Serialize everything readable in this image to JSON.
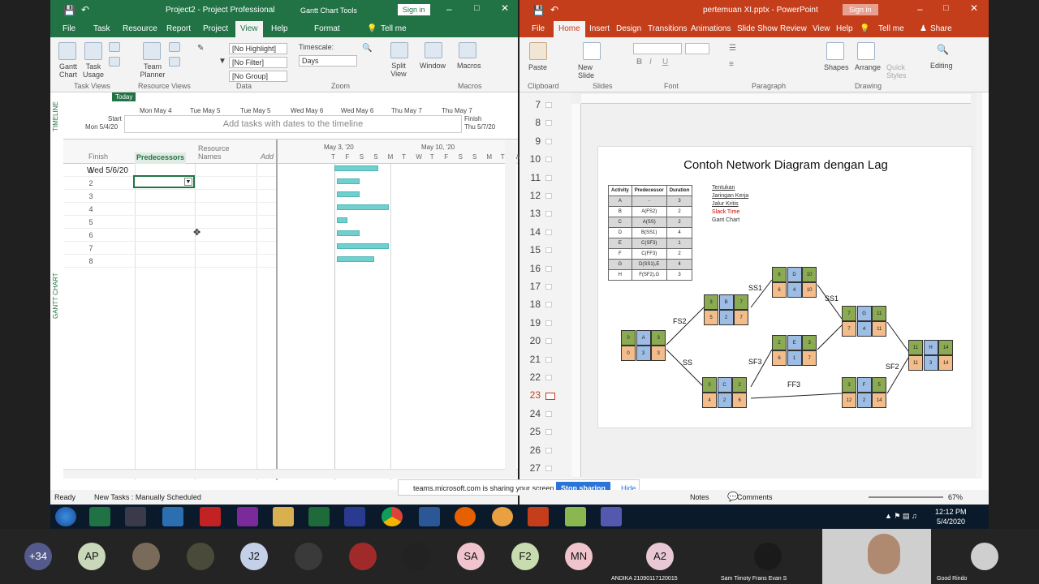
{
  "project": {
    "title": "Project2 - Project Professional",
    "tools": "Gantt Chart Tools",
    "sign_in": "Sign in",
    "tabs": [
      "File",
      "Task",
      "Resource",
      "Report",
      "Project",
      "View",
      "Help",
      "Format"
    ],
    "tell_me": "Tell me",
    "ribbon": {
      "gantt_chart": "Gantt Chart",
      "task_usage": "Task Usage",
      "team_planner": "Team Planner",
      "highlight": "[No Highlight]",
      "filter": "[No Filter]",
      "group": "[No Group]",
      "timescale_label": "Timescale:",
      "timescale": "Days",
      "split_view": "Split View",
      "window": "Window",
      "macros": "Macros",
      "groups": [
        "Task Views",
        "Resource Views",
        "Data",
        "Zoom",
        "Macros"
      ]
    },
    "timeline": {
      "label": "TIMELINE",
      "today": "Today",
      "ticks": [
        "Mon May 4",
        "Tue May 5",
        "Tue May 5",
        "Wed May 6",
        "Wed May 6",
        "Thu May 7",
        "Thu May 7"
      ],
      "start_label": "Start",
      "start_date": "Mon 5/4/20",
      "placeholder": "Add tasks with dates to the timeline",
      "finish_label": "Finish",
      "finish_date": "Thu 5/7/20"
    },
    "gantt_label": "GANTT CHART",
    "columns": [
      "Finish",
      "Predecessors",
      "Resource Names",
      "Add"
    ],
    "week1": "May 3, '20",
    "week2": "May 10, '20",
    "days": [
      "T",
      "F",
      "S",
      "S",
      "M",
      "T",
      "W",
      "T",
      "F",
      "S",
      "S",
      "M",
      "T",
      "W",
      "T",
      "F"
    ],
    "rows": [
      {
        "n": "1",
        "finish": "Wed 5/6/20"
      },
      {
        "n": "2",
        "finish": ""
      },
      {
        "n": "3",
        "finish": ""
      },
      {
        "n": "4",
        "finish": ""
      },
      {
        "n": "5",
        "finish": ""
      },
      {
        "n": "6",
        "finish": ""
      },
      {
        "n": "7",
        "finish": ""
      },
      {
        "n": "8",
        "finish": ""
      }
    ],
    "status_ready": "Ready",
    "status_tasks": "New Tasks : Manually Scheduled"
  },
  "ppt": {
    "title": "pertemuan XI.pptx - PowerPoint",
    "sign_in": "Sign in",
    "tabs": [
      "File",
      "Home",
      "Insert",
      "Design",
      "Transitions",
      "Animations",
      "Slide Show",
      "Review",
      "View",
      "Help"
    ],
    "tell_me": "Tell me",
    "share": "Share",
    "ribbon": {
      "paste": "Paste",
      "new_slide": "New Slide",
      "shapes": "Shapes",
      "arrange": "Arrange",
      "quick_styles": "Quick Styles",
      "editing": "Editing",
      "groups": [
        "Clipboard",
        "Slides",
        "Font",
        "Paragraph",
        "Drawing"
      ]
    },
    "slide_numbers": [
      "7",
      "8",
      "9",
      "10",
      "11",
      "12",
      "13",
      "14",
      "15",
      "16",
      "17",
      "18",
      "19",
      "20",
      "21",
      "22",
      "23",
      "24",
      "25",
      "26",
      "27"
    ],
    "slide_title": "Contoh Network Diagram dengan Lag",
    "table_head": [
      "Activity",
      "Predecessor",
      "Duration"
    ],
    "table_rows": [
      [
        "A",
        "-",
        "3"
      ],
      [
        "B",
        "A(FS2)",
        "2"
      ],
      [
        "C",
        "A(SS)",
        "2"
      ],
      [
        "D",
        "B(SS1)",
        "4"
      ],
      [
        "E",
        "C(SF3)",
        "1"
      ],
      [
        "F",
        "C(FF3)",
        "2"
      ],
      [
        "G",
        "D(SS1),E",
        "4"
      ],
      [
        "H",
        "F(SF2),G",
        "3"
      ]
    ],
    "bullets": [
      "Tentukan",
      "Jaringan Kerja",
      "Jalur Kritis",
      "Slack Time",
      "Gant Chart"
    ],
    "links": [
      "FS2",
      "SS",
      "SS1",
      "SF3",
      "FF3",
      "SS1",
      "SF2"
    ],
    "notes": "Notes",
    "comments": "Comments",
    "zoom": "67%"
  },
  "share_bar": {
    "text": "teams.microsoft.com is sharing your screen.",
    "stop": "Stop sharing",
    "hide": "Hide"
  },
  "clock": {
    "time": "12:12 PM",
    "date": "5/4/2020"
  },
  "participants": [
    {
      "label": "+34",
      "color": "#555a8c"
    },
    {
      "label": "AP",
      "color": "#c8d8b8"
    },
    {
      "label": "",
      "color": "#7a6a5a"
    },
    {
      "label": "",
      "color": "#4a4a3a"
    },
    {
      "label": "J2",
      "color": "#c4d0e8"
    },
    {
      "label": "",
      "color": "#3a3a3a"
    },
    {
      "label": "",
      "color": "#a02a2a"
    },
    {
      "label": "",
      "color": "#222"
    },
    {
      "label": "SA",
      "color": "#f0c4cc"
    },
    {
      "label": "F2",
      "color": "#c8dcb0"
    },
    {
      "label": "MN",
      "color": "#f0c4cc"
    },
    {
      "label": "A2",
      "color": "#e8c8d4"
    },
    {
      "label": "",
      "color": "#1a1a1a"
    },
    {
      "label": "",
      "color": "#cfcfcf"
    }
  ],
  "names": {
    "andika": "ANDIKA 21090117120015",
    "sam": "Sam Timoty Frans Evan S",
    "good": "Good Rindo"
  }
}
